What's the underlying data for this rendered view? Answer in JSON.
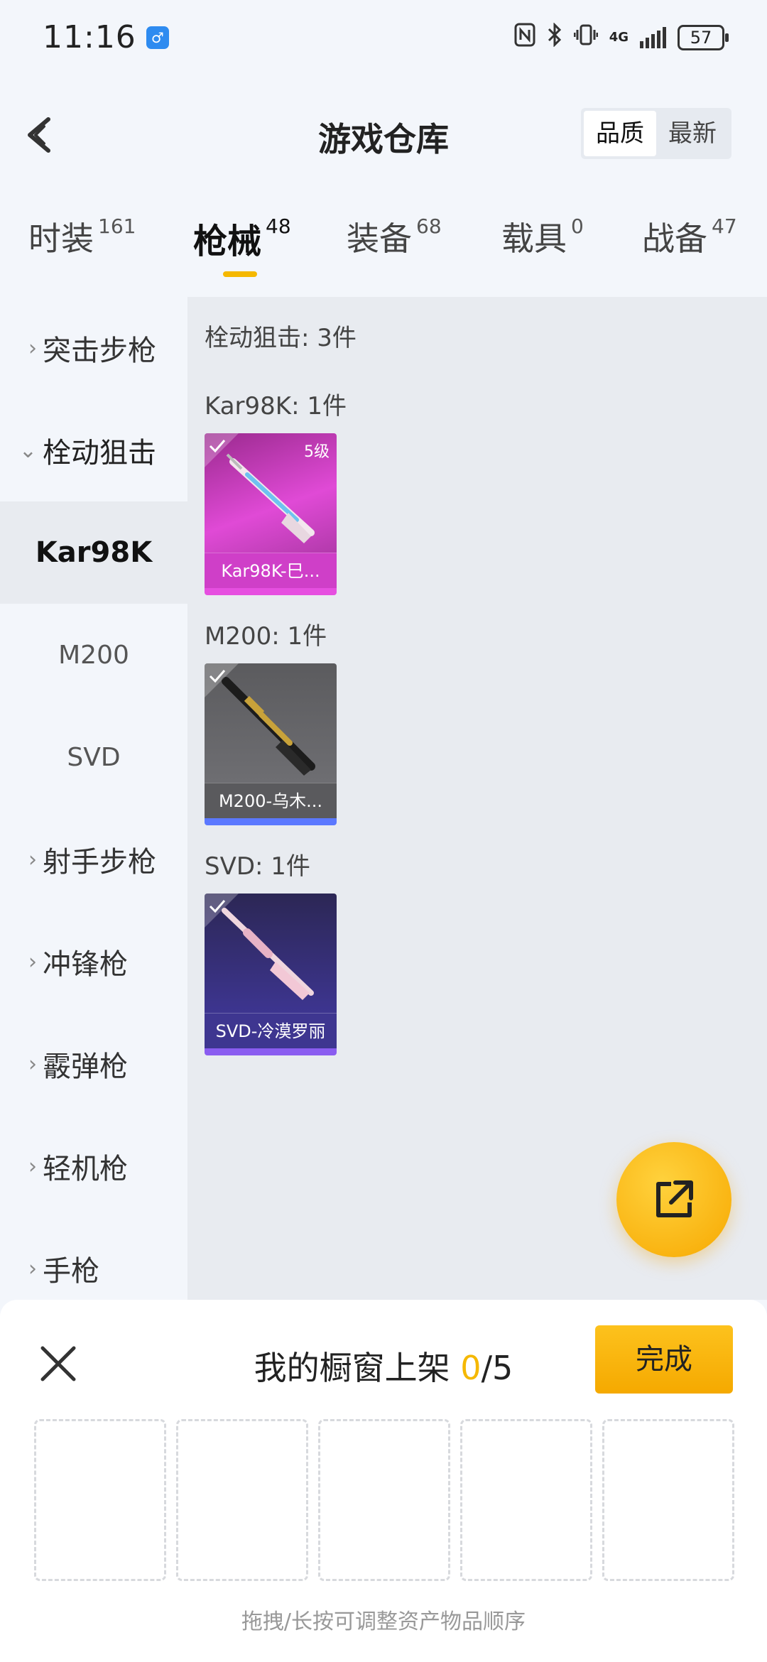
{
  "status": {
    "time": "11:16",
    "network": "4G",
    "battery": "57"
  },
  "header": {
    "title": "游戏仓库",
    "sort_options": [
      "品质",
      "最新"
    ],
    "sort_selected": "品质"
  },
  "tabs": [
    {
      "label": "时装",
      "count": "161"
    },
    {
      "label": "枪械",
      "count": "48",
      "active": true
    },
    {
      "label": "装备",
      "count": "68"
    },
    {
      "label": "载具",
      "count": "0"
    },
    {
      "label": "战备",
      "count": "47"
    }
  ],
  "sidebar": {
    "categories": [
      {
        "label": "突击步枪"
      },
      {
        "label": "栓动狙击",
        "open": true
      },
      {
        "label": "射手步枪"
      },
      {
        "label": "冲锋枪"
      },
      {
        "label": "霰弹枪"
      },
      {
        "label": "轻机枪"
      },
      {
        "label": "手枪"
      }
    ],
    "subitems": [
      "Kar98K",
      "M200",
      "SVD"
    ],
    "selected_subitem": "Kar98K"
  },
  "content": {
    "summary": "栓动狙击: 3件",
    "groups": [
      {
        "title": "Kar98K: 1件",
        "item_label": "Kar98K-巳...",
        "level": "5级",
        "rarity_color": "#d733c9"
      },
      {
        "title": "M200: 1件",
        "item_label": "M200-乌木...",
        "rarity_color": "#5b78ff"
      },
      {
        "title": "SVD: 1件",
        "item_label": "SVD-冷漠罗丽",
        "rarity_color": "#8a5cf0"
      }
    ]
  },
  "panel": {
    "title": "我的橱窗上架",
    "count_current": "0",
    "count_total": "/5",
    "done_label": "完成",
    "hint": "拖拽/长按可调整资产物品顺序"
  },
  "colors": {
    "accent": "#f5b800",
    "background": "#f3f6fb"
  }
}
